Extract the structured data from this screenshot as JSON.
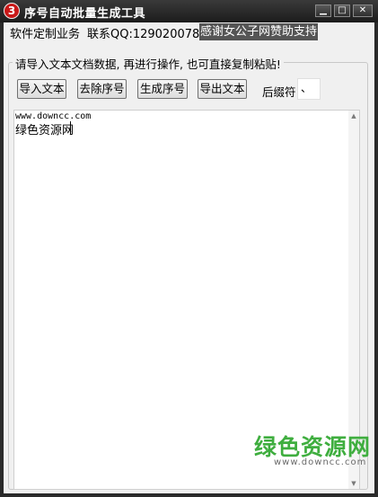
{
  "window": {
    "icon_glyph": "3",
    "title": "序号自动批量生成工具",
    "minimize_glyph": "▁",
    "maximize_glyph": "□",
    "close_glyph": "✕"
  },
  "info": {
    "custom_service": "软件定制业务",
    "contact_qq": "联系QQ:1290200788",
    "sponsor": "感谢女公子网赞助支持"
  },
  "group": {
    "caption": "请导入文本文档数据, 再进行操作, 也可直接复制粘贴!"
  },
  "buttons": {
    "import": "导入文本",
    "remove_numbers": "去除序号",
    "generate_numbers": "生成序号",
    "export": "导出文本"
  },
  "suffix": {
    "label": "后缀符",
    "value": "、"
  },
  "editor": {
    "lines": [
      "www.downcc.com",
      "绿色资源网"
    ],
    "scroll_up_glyph": "▲",
    "scroll_down_glyph": "▼"
  },
  "watermark": {
    "logo_text": "绿色资源网",
    "url": "www.downcc.com"
  },
  "colors": {
    "titlebar": "#1c1c1c",
    "client_background": "#f0f0f0",
    "sponsor_background": "#555555",
    "app_icon": "#c81818",
    "watermark_green": "#3fae3f"
  },
  "icons": {
    "app": "app-logo-icon",
    "minimize": "minimize-icon",
    "maximize": "maximize-icon",
    "close": "close-icon"
  }
}
